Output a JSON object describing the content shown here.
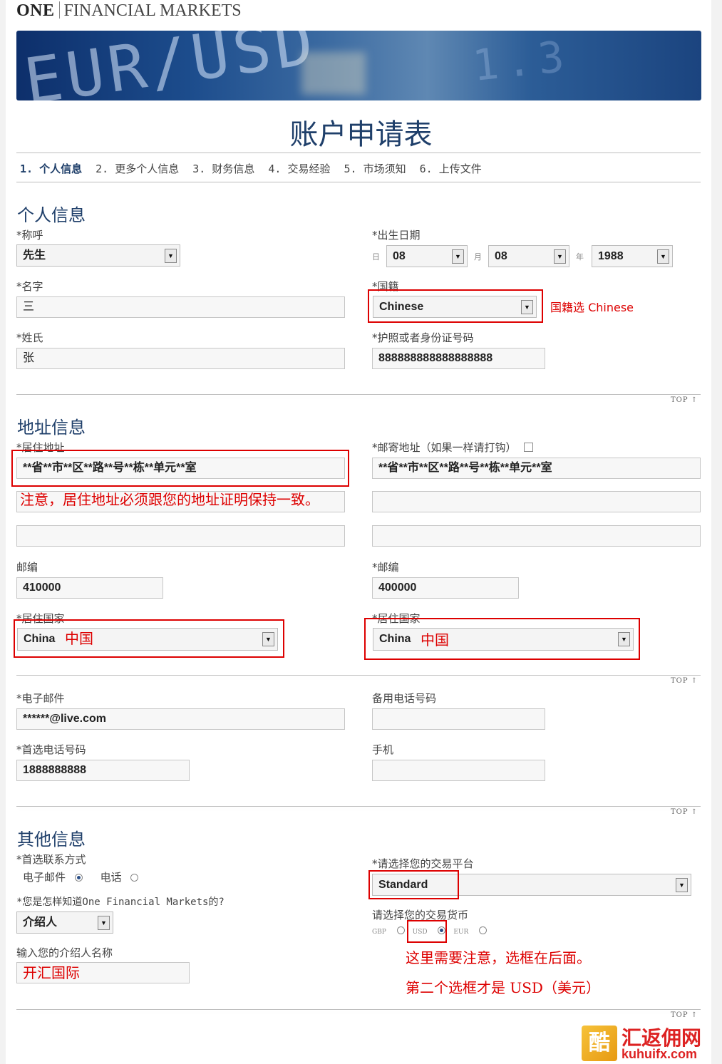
{
  "brand": {
    "one": "ONE",
    "rest": "FINANCIAL MARKETS"
  },
  "banner": {
    "text1": "EUR/USD",
    "text2": "1.3"
  },
  "page_title": "账户申请表",
  "steps": [
    "1. 个人信息",
    "2. 更多个人信息",
    "3. 财务信息",
    "4. 交易经验",
    "5. 市场须知",
    "6. 上传文件"
  ],
  "personal": {
    "heading": "个人信息",
    "salutation_label": "*称呼",
    "salutation_value": "先生",
    "first_name_label": "*名字",
    "first_name_value": "三",
    "last_name_label": "*姓氏",
    "last_name_value": "张",
    "dob_label": "*出生日期",
    "dob_day_label": "日",
    "dob_day": "08",
    "dob_month_label": "月",
    "dob_month": "08",
    "dob_year_label": "年",
    "dob_year": "1988",
    "nationality_label": "*国籍",
    "nationality_value": "Chinese",
    "nationality_note": "国籍选 Chinese",
    "passport_label": "*护照或者身份证号码",
    "passport_value": "888888888888888888"
  },
  "address": {
    "heading": "地址信息",
    "residential_label": "*居住地址",
    "residential_line1": "**省**市**区**路**号**栋**单元**室",
    "residential_note": "注意，居住地址必须跟您的地址证明保持一致。",
    "mailing_label": "*邮寄地址（如果一样请打钩）",
    "mailing_line1": "**省**市**区**路**号**栋**单元**室",
    "zip_left_label": "邮编",
    "zip_left_value": "410000",
    "zip_right_label": "*邮编",
    "zip_right_value": "400000",
    "country_left_label": "*居住国家",
    "country_left_value": "China",
    "country_left_note": "中国",
    "country_right_label": "*居住国家",
    "country_right_value": "China",
    "country_right_note": "中国"
  },
  "contact": {
    "email_label": "*电子邮件",
    "email_value": "******@live.com",
    "alt_phone_label": "备用电话号码",
    "alt_phone_value": "",
    "phone_label": "*首选电话号码",
    "phone_value": "1888888888",
    "mobile_label": "手机",
    "mobile_value": ""
  },
  "other": {
    "heading": "其他信息",
    "contact_method_label": "*首选联系方式",
    "contact_email": "电子邮件",
    "contact_phone": "电话",
    "source_label": "*您是怎样知道One Financial Markets的?",
    "source_value": "介绍人",
    "referrer_label": "输入您的介绍人名称",
    "referrer_value": "开汇国际",
    "platform_label": "*请选择您的交易平台",
    "platform_value": "Standard",
    "currency_label": "请选择您的交易货币",
    "currency_gbp": "GBP",
    "currency_usd": "USD",
    "currency_eur": "EUR",
    "note_line1": "这里需要注意，选框在后面。",
    "note_line2": "第二个选框才是 USD（美元）"
  },
  "top_label": "TOP",
  "watermark": {
    "title": "汇返佣网",
    "url": "kuhuifx.com",
    "mark": "酷"
  },
  "colors": {
    "accent": "#1f3f6a",
    "annotation": "#dd0000"
  }
}
